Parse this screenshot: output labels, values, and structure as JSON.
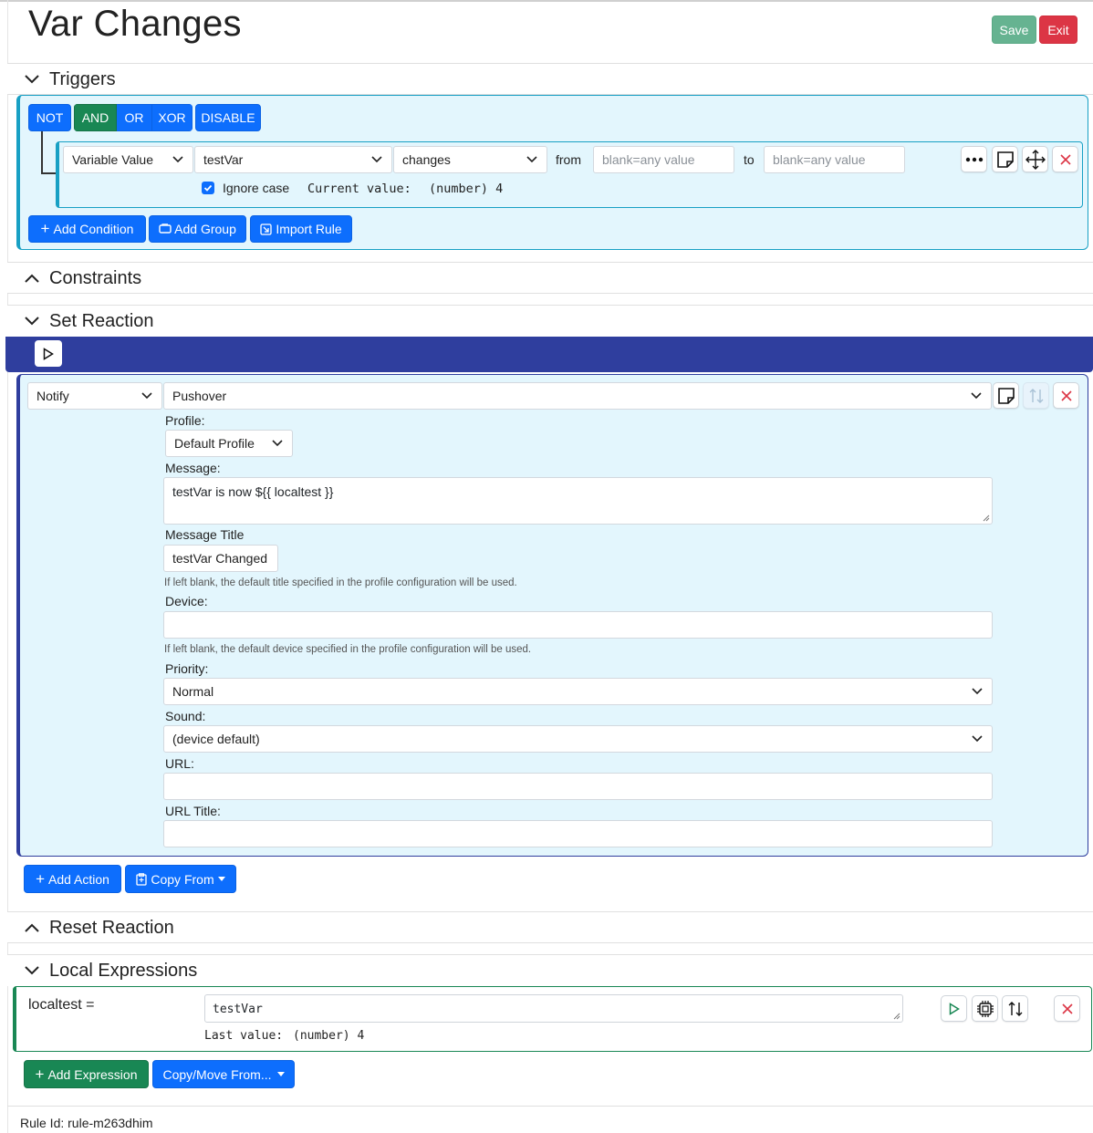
{
  "page": {
    "title": "Var Changes",
    "save_label": "Save",
    "exit_label": "Exit"
  },
  "sections": {
    "triggers": "Triggers",
    "constraints": "Constraints",
    "set_reaction": "Set Reaction",
    "reset_reaction": "Reset Reaction",
    "local_expressions": "Local Expressions"
  },
  "triggers": {
    "logic_buttons": [
      "NOT",
      "AND",
      "OR",
      "XOR",
      "DISABLE"
    ],
    "active_logic": "AND",
    "condition": {
      "type": "Variable Value",
      "variable": "testVar",
      "comparison": "changes",
      "from_label": "from",
      "from_placeholder": "blank=any value",
      "to_label": "to",
      "to_placeholder": "blank=any value",
      "ignore_case_label": "Ignore case",
      "ignore_case_checked": true,
      "current_value_label": "Current value:",
      "current_value": "(number) 4"
    },
    "add_condition": "Add Condition",
    "add_group": "Add Group",
    "import_rule": "Import Rule"
  },
  "action": {
    "type": "Notify",
    "service": "Pushover",
    "profile_label": "Profile:",
    "profile_value": "Default Profile",
    "message_label": "Message:",
    "message_value": "testVar is now ${{ localtest }}",
    "title_label": "Message Title",
    "title_value": "testVar Changed",
    "title_help": "If left blank, the default title specified in the profile configuration will be used.",
    "device_label": "Device:",
    "device_value": "",
    "device_help": "If left blank, the default device specified in the profile configuration will be used.",
    "priority_label": "Priority:",
    "priority_value": "Normal",
    "sound_label": "Sound:",
    "sound_value": "(device default)",
    "url_label": "URL:",
    "url_value": "",
    "url_title_label": "URL Title:",
    "url_title_value": ""
  },
  "reaction_buttons": {
    "add_action": "Add Action",
    "copy_from": "Copy From"
  },
  "local_expr": {
    "name": "localtest =",
    "expression": "testVar",
    "last_value_label": "Last value:",
    "last_value": "(number) 4",
    "add_expression": "Add Expression",
    "copy_move_from": "Copy/Move From..."
  },
  "footer": {
    "rule_id": "Rule Id: rule-m263dhim"
  },
  "colors": {
    "primary": "#0d6efd",
    "success": "#198754",
    "danger": "#dc3545",
    "panel_bg": "#e3f6fd",
    "reaction_bar": "#2f3e9e",
    "teal_border": "#18a0c4"
  }
}
